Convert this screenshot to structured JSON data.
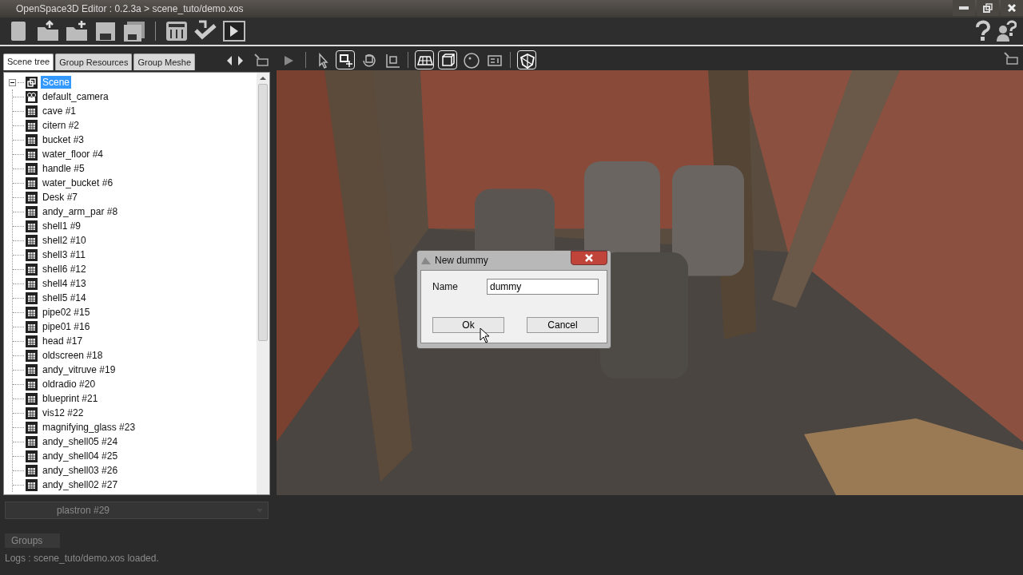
{
  "window": {
    "title": "OpenSpace3D Editor : 0.2.3a > scene_tuto/demo.xos"
  },
  "toolbar": {
    "buttons": [
      {
        "kind": "new"
      },
      {
        "kind": "open"
      },
      {
        "kind": "add"
      },
      {
        "kind": "save"
      },
      {
        "kind": "saveas"
      },
      {
        "kind": "sep"
      },
      {
        "kind": "settings"
      },
      {
        "kind": "export"
      },
      {
        "kind": "play"
      }
    ]
  },
  "tabs": [
    {
      "label": "Scene tree",
      "selected": true
    },
    {
      "label": "Group Resources",
      "selected": false
    },
    {
      "label": "Group Meshe",
      "selected": false
    }
  ],
  "tree": {
    "label": "Scene",
    "expanded": true,
    "selected": true,
    "children": [
      {
        "label": "default_camera",
        "kind": "camera"
      },
      {
        "label": "cave #1",
        "kind": "mesh"
      },
      {
        "label": "citern #2",
        "kind": "mesh"
      },
      {
        "label": "bucket #3",
        "kind": "mesh"
      },
      {
        "label": "water_floor #4",
        "kind": "mesh"
      },
      {
        "label": "handle #5",
        "kind": "mesh"
      },
      {
        "label": "water_bucket #6",
        "kind": "mesh"
      },
      {
        "label": "Desk #7",
        "kind": "mesh"
      },
      {
        "label": "andy_arm_par #8",
        "kind": "mesh"
      },
      {
        "label": "shell1 #9",
        "kind": "mesh"
      },
      {
        "label": "shell2 #10",
        "kind": "mesh"
      },
      {
        "label": "shell3 #11",
        "kind": "mesh"
      },
      {
        "label": "shell6 #12",
        "kind": "mesh"
      },
      {
        "label": "shell4 #13",
        "kind": "mesh"
      },
      {
        "label": "shell5 #14",
        "kind": "mesh"
      },
      {
        "label": "pipe02 #15",
        "kind": "mesh"
      },
      {
        "label": "pipe01 #16",
        "kind": "mesh"
      },
      {
        "label": "head #17",
        "kind": "mesh"
      },
      {
        "label": "oldscreen #18",
        "kind": "mesh"
      },
      {
        "label": "andy_vitruve #19",
        "kind": "mesh"
      },
      {
        "label": "oldradio #20",
        "kind": "mesh"
      },
      {
        "label": "blueprint #21",
        "kind": "mesh"
      },
      {
        "label": "vis12 #22",
        "kind": "mesh"
      },
      {
        "label": "magnifying_glass #23",
        "kind": "mesh"
      },
      {
        "label": "andy_shell05 #24",
        "kind": "mesh"
      },
      {
        "label": "andy_shell04 #25",
        "kind": "mesh"
      },
      {
        "label": "andy_shell03 #26",
        "kind": "mesh"
      },
      {
        "label": "andy_shell02 #27",
        "kind": "mesh"
      }
    ]
  },
  "combo": {
    "value": "plastron #29"
  },
  "bottom_tabs": [
    {
      "label": "Groups"
    }
  ],
  "log": "Logs : scene_tuto/demo.xos loaded.",
  "view_toolbar": [
    {
      "kind": "play",
      "selected": false
    },
    {
      "kind": "sep"
    },
    {
      "kind": "select",
      "selected": false
    },
    {
      "kind": "move",
      "selected": true
    },
    {
      "kind": "rotate",
      "selected": false
    },
    {
      "kind": "scale",
      "selected": false
    },
    {
      "kind": "sep"
    },
    {
      "kind": "grid",
      "selected": true
    },
    {
      "kind": "box",
      "selected": true
    },
    {
      "kind": "sphere",
      "selected": false
    },
    {
      "kind": "info",
      "selected": false
    },
    {
      "kind": "sep"
    },
    {
      "kind": "shield",
      "selected": true
    }
  ],
  "dialog": {
    "title": "New dummy",
    "fields": [
      {
        "label": "Name",
        "value": "dummy"
      }
    ],
    "buttons": [
      {
        "label": "Ok"
      },
      {
        "label": "Cancel"
      }
    ]
  }
}
